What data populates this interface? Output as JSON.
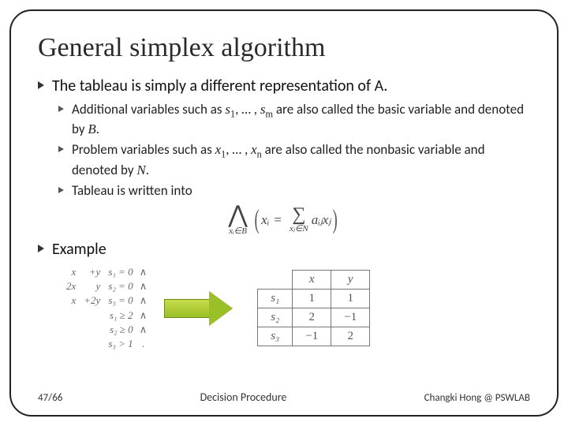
{
  "title": "General simplex algorithm",
  "bullets": {
    "p1": "The tableau is simply a different representation of A.",
    "sub1_a": "Additional variables such as ",
    "sub1_vars1": "s",
    "sub1_mid": ", … , ",
    "sub1_vars2": "s",
    "sub1_b": " are also called the basic variable and denoted by ",
    "sub1_B": "B",
    "sub1_end": ".",
    "sub2_a": "Problem variables such as ",
    "sub2_vars1": "x",
    "sub2_mid": ", … , ",
    "sub2_vars2": "x",
    "sub2_b": " are also called the nonbasic variable and denoted by ",
    "sub2_N": "N",
    "sub2_end": ".",
    "sub3": "Tableau is written into",
    "p2": "Example"
  },
  "formula": {
    "wedge_sub": "xᵢ∈B",
    "lhs": "xᵢ",
    "sigma_sub": "xⱼ∈N",
    "rhs": "aᵢⱼxⱼ"
  },
  "eqlist": {
    "r1": {
      "c1": "x",
      "c2": "+y",
      "c3": "s₁ = 0",
      "c4": "∧"
    },
    "r2": {
      "c1": "2x",
      "c2": "y",
      "c3": "s₂ = 0",
      "c4": "∧"
    },
    "r3": {
      "c1": "x",
      "c2": "+2y",
      "c3": "s₃ = 0",
      "c4": "∧"
    },
    "r4": {
      "c1": "",
      "c2": "",
      "c3": "s₁ ≥ 2",
      "c4": "∧"
    },
    "r5": {
      "c1": "",
      "c2": "",
      "c3": "s₂ ≥ 0",
      "c4": "∧"
    },
    "r6": {
      "c1": "",
      "c2": "",
      "c3": "s₃ > 1",
      "c4": "."
    }
  },
  "matrix": {
    "h1": "x",
    "h2": "y",
    "r1": {
      "lbl": "s₁",
      "a": "1",
      "b": "1"
    },
    "r2": {
      "lbl": "s₂",
      "a": "2",
      "b": "−1"
    },
    "r3": {
      "lbl": "s₃",
      "a": "−1",
      "b": "2"
    }
  },
  "footer": {
    "left": "47/66",
    "mid": "Decision Procedure",
    "right": "Changki Hong @ PSWLAB"
  },
  "chart_data": {
    "type": "table",
    "title": "Tableau (basic vs nonbasic)",
    "columns": [
      "x",
      "y"
    ],
    "rows": [
      "s1",
      "s2",
      "s3"
    ],
    "values": [
      [
        1,
        1
      ],
      [
        2,
        -1
      ],
      [
        -1,
        2
      ]
    ]
  }
}
